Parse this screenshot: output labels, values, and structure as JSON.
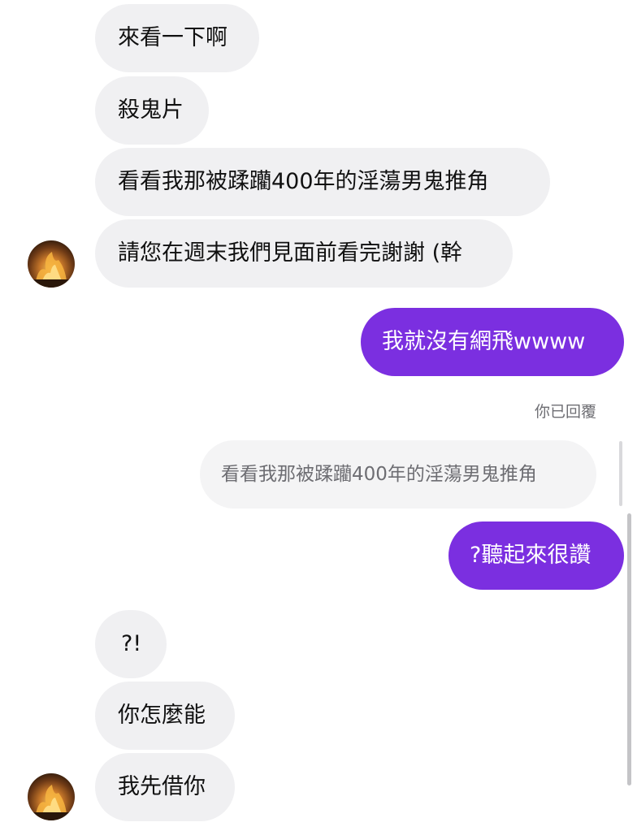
{
  "messages": [
    {
      "text": "來看一下啊"
    },
    {
      "text": "殺鬼片"
    },
    {
      "text": "看看我那被蹂躪400年的淫蕩男鬼推角"
    },
    {
      "text": "請您在週末我們見面前看完謝謝 (幹"
    },
    {
      "text": "我就沒有網飛wwww"
    },
    {
      "text": "看看我那被蹂躪400年的淫蕩男鬼推角"
    },
    {
      "text": "?聽起來很讚"
    },
    {
      "text": "?!"
    },
    {
      "text": "你怎麼能"
    },
    {
      "text": "我先借你"
    }
  ],
  "reply_label": "你已回覆",
  "colors": {
    "sent_bubble": "#7b2fe0",
    "received_bubble": "#f0f0f2"
  },
  "icons": {
    "avatar": "fire-avatar-photo"
  }
}
